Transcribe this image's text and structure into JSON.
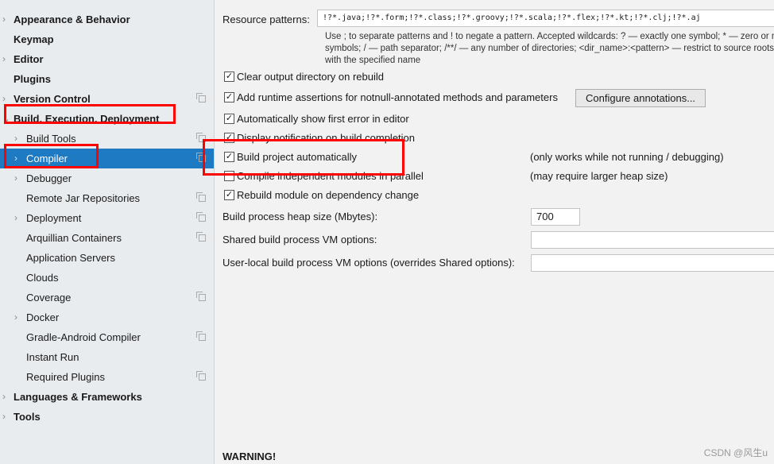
{
  "sidebar": {
    "items": [
      {
        "label": "Appearance & Behavior",
        "level": "top",
        "chevron": true
      },
      {
        "label": "Keymap",
        "level": "top"
      },
      {
        "label": "Editor",
        "level": "top",
        "chevron": true
      },
      {
        "label": "Plugins",
        "level": "top"
      },
      {
        "label": "Version Control",
        "level": "top",
        "chevron": true,
        "copy": true
      },
      {
        "label": "Build, Execution, Deployment",
        "level": "top",
        "chevron": true,
        "expanded": true
      },
      {
        "label": "Build Tools",
        "level": "sub",
        "chevron": true,
        "copy": true
      },
      {
        "label": "Compiler",
        "level": "sub",
        "chevron": true,
        "copy": true,
        "selected": true
      },
      {
        "label": "Debugger",
        "level": "sub",
        "chevron": true
      },
      {
        "label": "Remote Jar Repositories",
        "level": "sub",
        "copy": true
      },
      {
        "label": "Deployment",
        "level": "sub",
        "chevron": true,
        "copy": true
      },
      {
        "label": "Arquillian Containers",
        "level": "sub",
        "copy": true
      },
      {
        "label": "Application Servers",
        "level": "sub"
      },
      {
        "label": "Clouds",
        "level": "sub"
      },
      {
        "label": "Coverage",
        "level": "sub",
        "copy": true
      },
      {
        "label": "Docker",
        "level": "sub",
        "chevron": true
      },
      {
        "label": "Gradle-Android Compiler",
        "level": "sub",
        "copy": true
      },
      {
        "label": "Instant Run",
        "level": "sub"
      },
      {
        "label": "Required Plugins",
        "level": "sub",
        "copy": true
      },
      {
        "label": "Languages & Frameworks",
        "level": "top",
        "chevron": true
      },
      {
        "label": "Tools",
        "level": "top",
        "chevron": true
      }
    ]
  },
  "main": {
    "resource_label": "Resource patterns:",
    "resource_value": "!?*.java;!?*.form;!?*.class;!?*.groovy;!?*.scala;!?*.flex;!?*.kt;!?*.clj;!?*.aj",
    "hint": [
      "Use ; to separate patterns and ! to negate a pattern. Accepted wildcards: ? — exactly one symbol; * — zero or more",
      "symbols; / — path separator; /**/ — any number of directories; <dir_name>:<pattern> — restrict to source roots",
      "with the specified name"
    ],
    "checkboxes": [
      {
        "label": "Clear output directory on rebuild",
        "checked": true
      },
      {
        "label": "Add runtime assertions for notnull-annotated methods and parameters",
        "checked": true
      },
      {
        "label": "Automatically show first error in editor",
        "checked": true
      },
      {
        "label": "Display notification on build completion",
        "checked": true
      },
      {
        "label": "Build project automatically",
        "checked": true,
        "note": "(only works while not running / debugging)"
      },
      {
        "label": "Compile independent modules in parallel",
        "checked": false,
        "note": "(may require larger heap size)"
      },
      {
        "label": "Rebuild module on dependency change",
        "checked": true
      }
    ],
    "configure_button": "Configure annotations...",
    "heap_label": "Build process heap size (Mbytes):",
    "heap_value": "700",
    "shared_vm_label": "Shared build process VM options:",
    "shared_vm_value": "",
    "user_vm_label": "User-local build process VM options (overrides Shared options):",
    "user_vm_value": "",
    "warning": "WARNING!"
  },
  "watermark": "CSDN @风生u"
}
